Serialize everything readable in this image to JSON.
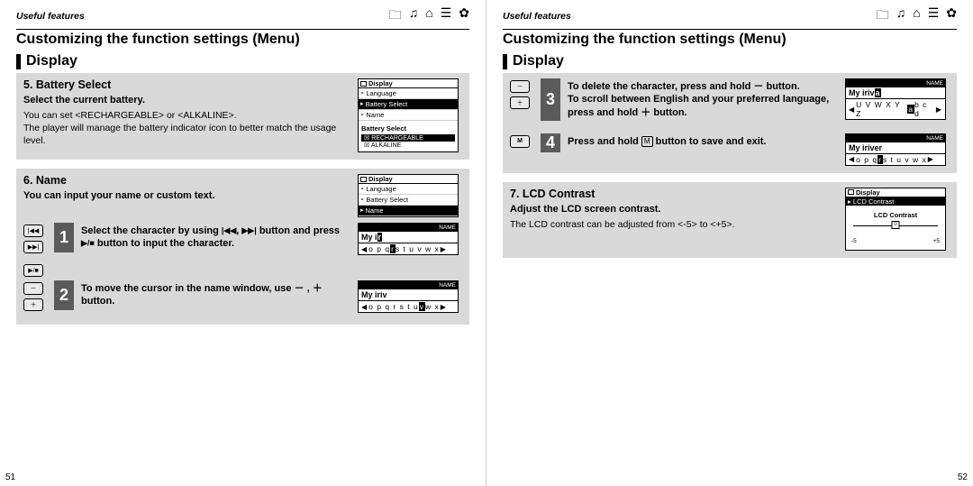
{
  "header": {
    "breadcrumb": "Useful features",
    "title": "Customizing the function settings (Menu)",
    "section": "Display",
    "icons": [
      "folder",
      "music",
      "home",
      "list",
      "gear"
    ]
  },
  "page_numbers": {
    "left": "51",
    "right": "52"
  },
  "battery_select": {
    "title": "5. Battery Select",
    "subtitle": "Select the current battery.",
    "body1": "You can set  <RECHARGEABLE> or <ALKALINE>.",
    "body2": "The player will manage the battery indicator icon to better match the usage level.",
    "lcd": {
      "header": "Display",
      "items": [
        "Language",
        "Battery Select",
        "Name"
      ],
      "selected_index": 1,
      "sub_title": "Battery Select",
      "sub_items": [
        "RECHARGEABLE",
        "ALKALINE"
      ],
      "sub_selected_index": 0
    }
  },
  "name_section": {
    "title": "6. Name",
    "subtitle": "You can input your name or custom text.",
    "lcd": {
      "header": "Display",
      "items": [
        "Language",
        "Battery Select",
        "Name"
      ],
      "selected_index": 2
    },
    "step1": {
      "num": "1",
      "text_a": "Select the character by using ",
      "text_b": " button and press ",
      "text_c": " button to input the character.",
      "lcd": {
        "label": "NAME",
        "value_prefix": "My i",
        "cursor": "r",
        "chars": "o p q r s t u v w x",
        "hl_char": "r"
      }
    },
    "step2": {
      "num": "2",
      "text_a": "To move the cursor in the name window, use ",
      "text_b": "－ ,  ＋ button.",
      "lcd": {
        "label": "NAME",
        "value_prefix": "My iriv",
        "chars": "o p q r s t u v w x",
        "hl_char": "v"
      }
    }
  },
  "right_steps": {
    "step3": {
      "num": "3",
      "line1_a": "To delete the character, press and hold  ",
      "line1_b": "－",
      "line1_c": "  button.",
      "line2": "To scroll between English and your preferred language, press and hold  ＋ button.",
      "lcd": {
        "label": "NAME",
        "value_prefix": "My iriv",
        "cursor": "a",
        "chars": "U V W X Y Z a b c d",
        "hl_char": "a"
      }
    },
    "step4": {
      "num": "4",
      "text_a": "Press and hold ",
      "text_b": " button to save and exit.",
      "key": "M",
      "lcd": {
        "label": "NAME",
        "value": "My iriver",
        "chars": "o p q r s t u v w x",
        "hl_char": "r"
      }
    }
  },
  "lcd_contrast": {
    "title": "7. LCD Contrast",
    "subtitle": "Adjust the LCD screen contrast.",
    "body": "The LCD contrast can be adjusted from <-5> to <+5>.",
    "lcd": {
      "header": "Display",
      "selected": "LCD Contrast",
      "gauge_title": "LCD Contrast",
      "value": "0",
      "min": "-5",
      "max": "+5"
    }
  },
  "buttons": {
    "prev": "|◀◀",
    "next": "▶▶|",
    "playstop": "▶/■",
    "minus": "－",
    "plus": "＋",
    "m": "M"
  }
}
